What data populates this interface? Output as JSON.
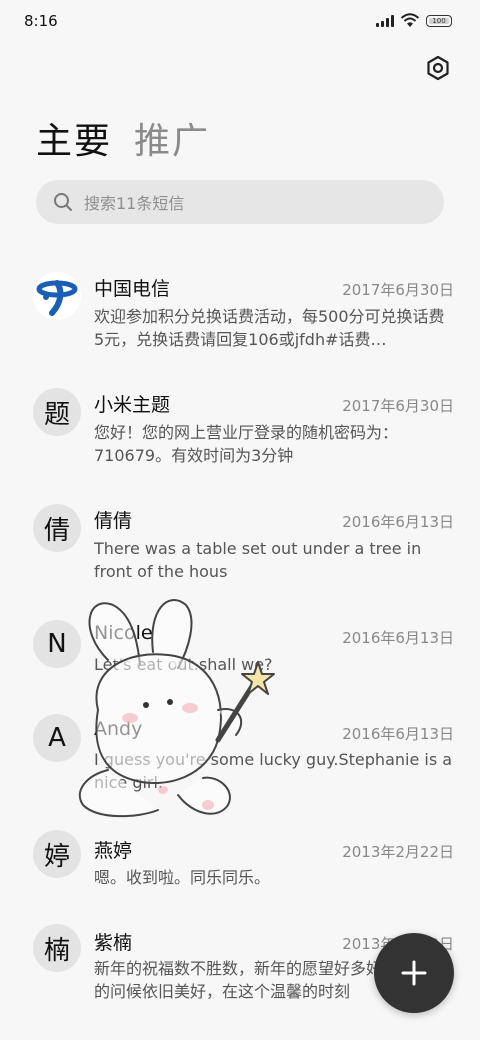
{
  "status": {
    "time": "8:16",
    "battery": "100"
  },
  "tabs": {
    "primary": "主要",
    "secondary": "推广"
  },
  "search": {
    "placeholder": "搜索11条短信"
  },
  "messages": [
    {
      "avatar": "",
      "name": "中国电信",
      "date": "2017年6月30日",
      "preview": "欢迎参加积分兑换话费活动，每500分可兑换话费5元，兑换话费请回复106或jfdh#话费…"
    },
    {
      "avatar": "题",
      "name": "小米主题",
      "date": "2017年6月30日",
      "preview": "您好！您的网上营业厅登录的随机密码为：710679。有效时间为3分钟"
    },
    {
      "avatar": "倩",
      "name": "倩倩",
      "date": "2016年6月13日",
      "preview": "There was a table set out under a tree in front of the hous"
    },
    {
      "avatar": "N",
      "name": "Nicole",
      "date": "2016年6月13日",
      "preview": "Let's eat out.shall we?"
    },
    {
      "avatar": "A",
      "name": "Andy",
      "date": "2016年6月13日",
      "preview": "I guess you're some lucky guy.Stephanie is a nice girl."
    },
    {
      "avatar": "婷",
      "name": "燕婷",
      "date": "2013年2月22日",
      "preview": "嗯。收到啦。同乐同乐。"
    },
    {
      "avatar": "楠",
      "name": "紫楠",
      "date": "2013年2月22日",
      "preview": "新年的祝福数不胜数，新年的愿望好多好多，新年的问候依旧美好，在这个温馨的时刻"
    }
  ],
  "colors": {
    "accent": "#333333",
    "background": "#f7f7f7",
    "avatar_bg": "#e3e3e3",
    "telecom_blue": "#1a5fb4"
  }
}
